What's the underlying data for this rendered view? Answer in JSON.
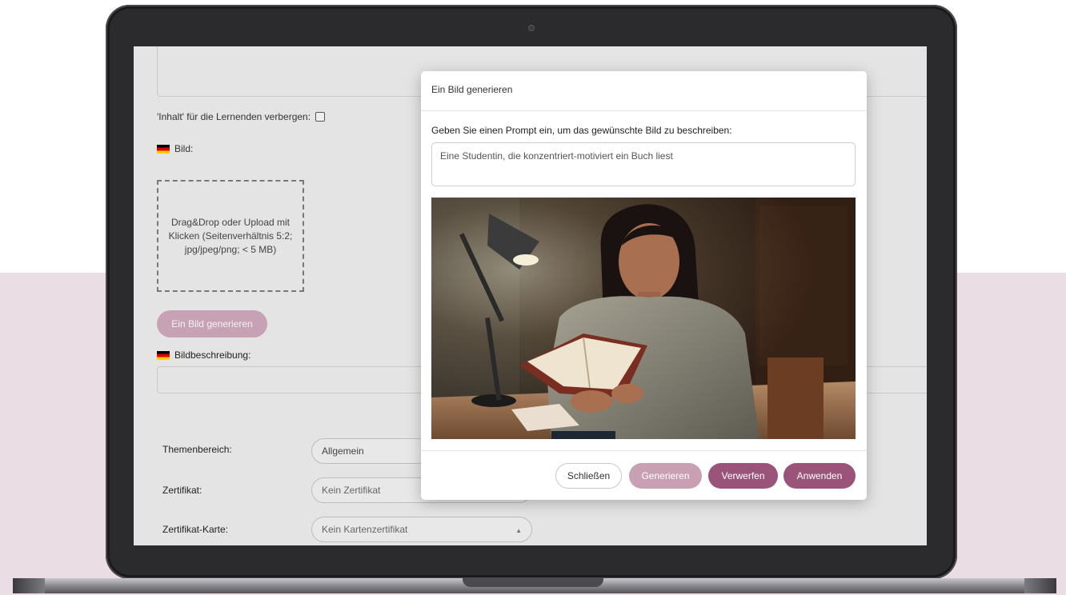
{
  "page": {
    "hide_content_label": "'Inhalt' für die Lernenden verbergen:",
    "image_label": "Bild:",
    "dropzone_text": "Drag&Drop oder Upload mit Klicken (Seitenverhältnis 5:2; jpg/jpeg/png; < 5 MB)",
    "generate_image_button": "Ein Bild generieren",
    "image_description_label": "Bildbeschreibung:",
    "fields": [
      {
        "label": "Themenbereich:",
        "value": "Allgemein"
      },
      {
        "label": "Zertifikat:",
        "value": "Kein Zertifikat"
      },
      {
        "label": "Zertifikat-Karte:",
        "value": "Kein Kartenzertifikat"
      }
    ]
  },
  "modal": {
    "title": "Ein Bild generieren",
    "prompt_label": "Geben Sie einen Prompt ein, um das gewünschte Bild zu beschreiben:",
    "prompt_value": "Eine Studentin, die konzentriert-motiviert ein Buch liest",
    "buttons": {
      "close": "Schließen",
      "generate": "Generieren",
      "discard": "Verwerfen",
      "apply": "Anwenden"
    }
  },
  "colors": {
    "accent": "#9b5479",
    "accent_light": "#c99fb4",
    "background_band": "#eadde3"
  },
  "icons": [
    "german-flag-icon",
    "checkbox-icon",
    "caret-up-icon",
    "camera-icon"
  ]
}
